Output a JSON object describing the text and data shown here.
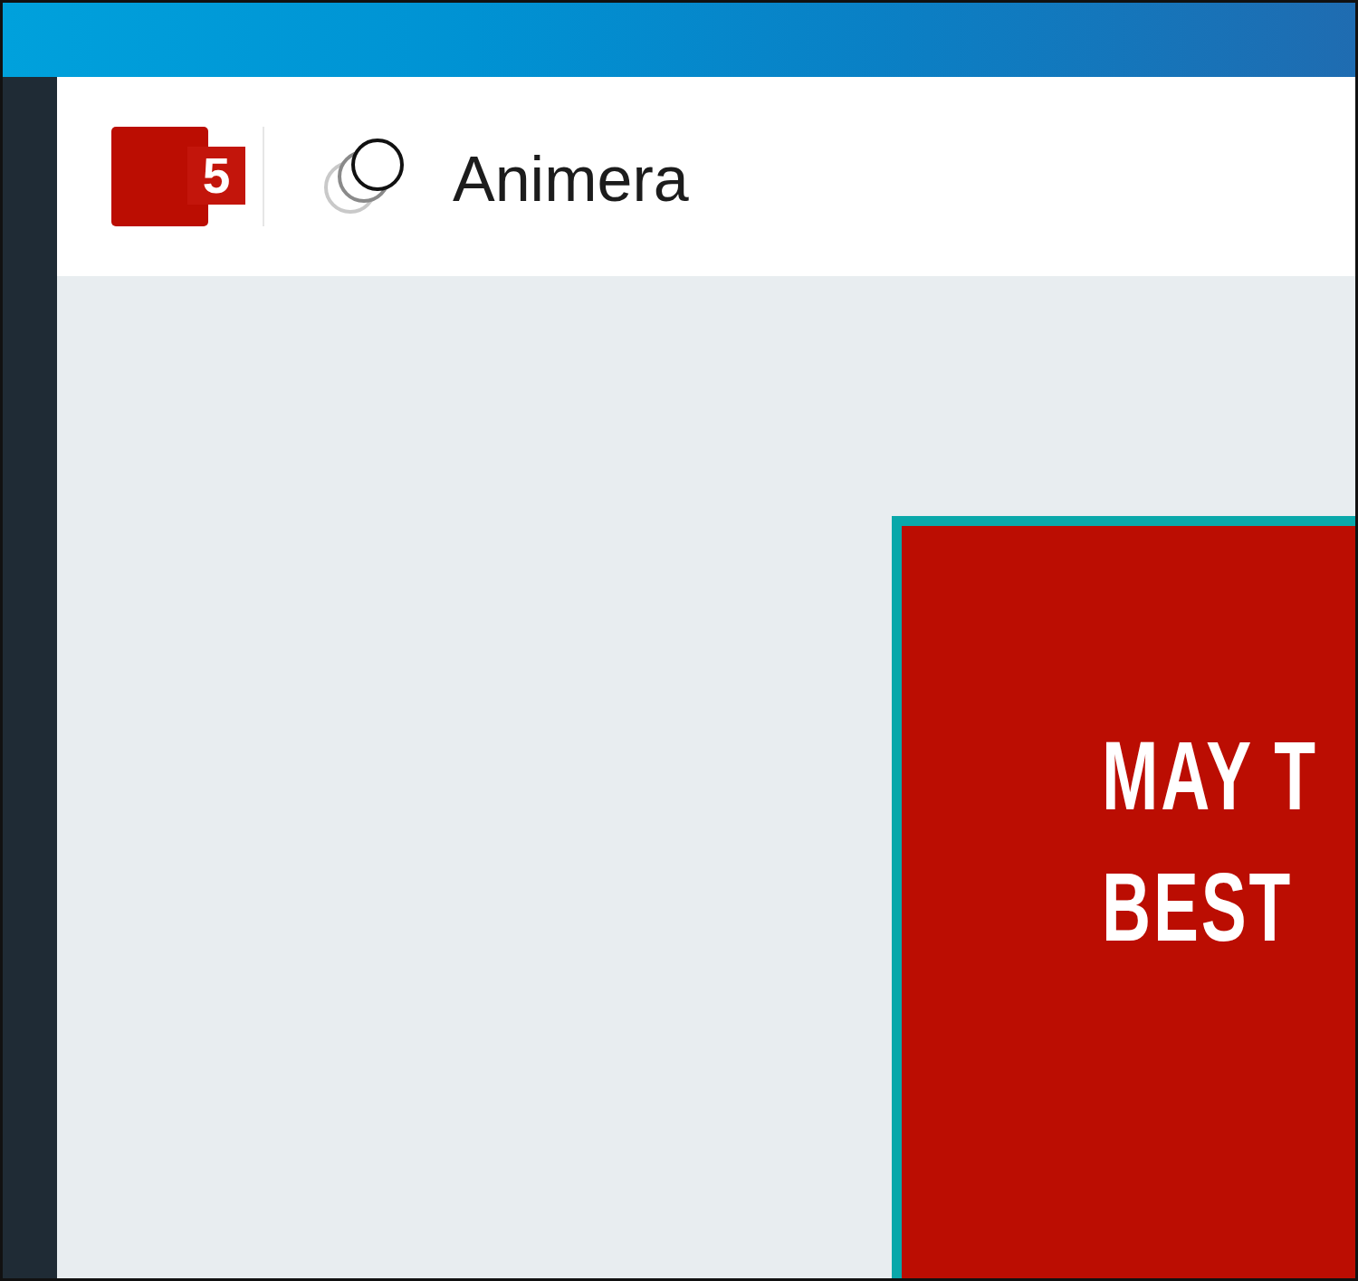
{
  "header": {
    "logo": {
      "badge": "5"
    },
    "app_title": "Animera"
  },
  "canvas": {
    "card": {
      "selected": true,
      "headline_lines": [
        "MAY T",
        "BEST"
      ]
    }
  }
}
